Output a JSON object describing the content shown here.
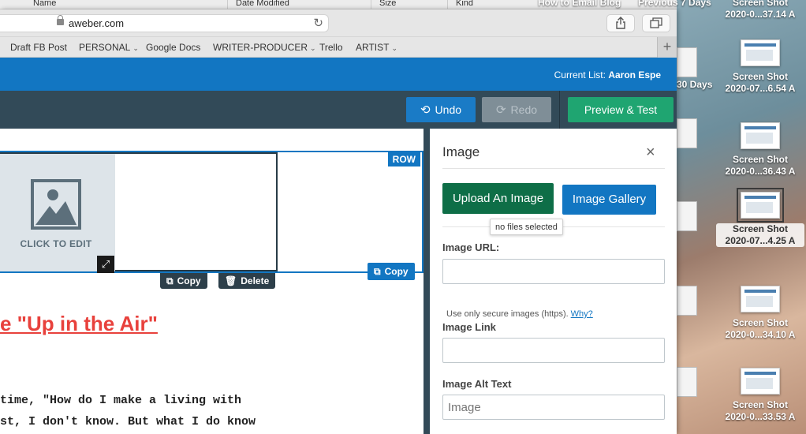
{
  "finder": {
    "col_name": "Name",
    "col_date": "Date Modified",
    "col_size": "Size",
    "col_kind": "Kind"
  },
  "browser": {
    "domain": "aweber.com",
    "bookmarks": [
      {
        "label": "Draft FB Post",
        "chevron": false
      },
      {
        "label": "PERSONAL",
        "chevron": true
      },
      {
        "label": "Google Docs",
        "chevron": false
      },
      {
        "label": "WRITER-PRODUCER",
        "chevron": true
      },
      {
        "label": "Trello",
        "chevron": false
      },
      {
        "label": "ARTIST",
        "chevron": true
      }
    ]
  },
  "aweber": {
    "current_list_label": "Current List:",
    "current_list_name": "Aaron Espe",
    "undo_label": "Undo",
    "redo_label": "Redo",
    "preview_label": "Preview & Test"
  },
  "canvas": {
    "row_badge": "ROW",
    "image_placeholder": "CLICK TO EDIT",
    "copy_label": "Copy",
    "delete_label": "Delete",
    "row_copy_label": "Copy",
    "headline": "e \"Up in the Air\"",
    "body_line_1": "time, \"How do I make a living with",
    "body_line_2": "st, I don't know. But what I do know"
  },
  "panel": {
    "title": "Image",
    "upload_label": "Upload An Image",
    "gallery_label": "Image Gallery",
    "tooltip": "no files selected",
    "url_label": "Image URL:",
    "url_value": "",
    "hint_text": "Use only secure images (https).",
    "hint_link": "Why?",
    "link_label": "Image Link",
    "link_value": "",
    "alt_label": "Image Alt Text",
    "alt_placeholder": "Image"
  },
  "desktop": {
    "behind_labels": [
      "How to Email Blog",
      "Previous 7 Days",
      "30 Days"
    ],
    "files": [
      {
        "line1": "Screen Shot",
        "line2": "2020-0...37.14 A",
        "thumb": false,
        "selected": false
      },
      {
        "line1": "Screen Shot",
        "line2": "2020-07...6.54 A",
        "thumb": true,
        "selected": false
      },
      {
        "line1": "Screen Shot",
        "line2": "2020-0...36.43 A",
        "thumb": true,
        "selected": false
      },
      {
        "line1": "Screen Shot",
        "line2": "2020-07...4.25 A",
        "thumb": true,
        "selected": true
      },
      {
        "line1": "Screen Shot",
        "line2": "2020-0...34.10 A",
        "thumb": true,
        "selected": false
      },
      {
        "line1": "Screen Shot",
        "line2": "2020-0...33.53 A",
        "thumb": true,
        "selected": false
      }
    ]
  },
  "colors": {
    "aweber_blue": "#1276c2",
    "toolbar_dark": "#324a58",
    "preview_green": "#1fa571",
    "upload_green": "#0e6e47",
    "headline_red": "#e8413c"
  }
}
